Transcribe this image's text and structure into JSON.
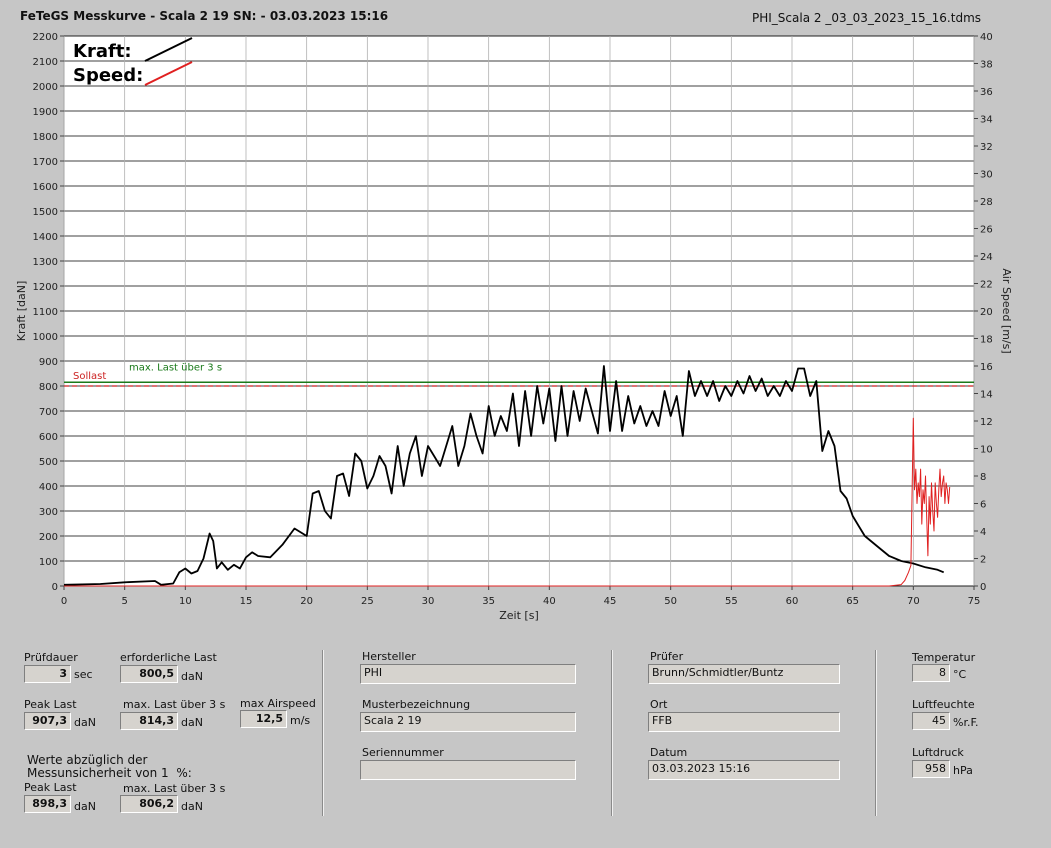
{
  "header": {
    "title": "FeTeGS Messkurve - Scala 2 19  SN:  - 03.03.2023 15:16",
    "filename": "PHI_Scala 2 _03_03_2023_15_16.tdms"
  },
  "chart_data": {
    "type": "line",
    "xlabel": "Zeit [s]",
    "ylabel": "Kraft [daN]",
    "y2label": "Air Speed [m/s]",
    "xlim": [
      0,
      75
    ],
    "ylim": [
      0,
      2200
    ],
    "y2lim": [
      0,
      40
    ],
    "x_ticks": [
      0,
      5,
      10,
      15,
      20,
      25,
      30,
      35,
      40,
      45,
      50,
      55,
      60,
      65,
      70,
      75
    ],
    "y_ticks": [
      0,
      100,
      200,
      300,
      400,
      500,
      600,
      700,
      800,
      900,
      1000,
      1100,
      1200,
      1300,
      1400,
      1500,
      1600,
      1700,
      1800,
      1900,
      2000,
      2100,
      2200
    ],
    "y2_ticks": [
      0,
      2,
      4,
      6,
      8,
      10,
      12,
      14,
      16,
      18,
      20,
      22,
      24,
      26,
      28,
      30,
      32,
      34,
      36,
      38,
      40
    ],
    "grid": true,
    "legend": [
      {
        "label": "Kraft:",
        "color": "#000000"
      },
      {
        "label": "Speed:",
        "color": "#e02020"
      }
    ],
    "reference_lines": [
      {
        "label": "Sollast",
        "value": 800,
        "color": "#cc2222",
        "style": "dashed"
      },
      {
        "label": "max. Last über  3 s",
        "value": 815,
        "color": "#1a7a1a",
        "style": "solid"
      }
    ],
    "series": [
      {
        "name": "Kraft",
        "axis": "left",
        "color": "#000000",
        "x": [
          0,
          3,
          5,
          7.5,
          8,
          9,
          9.5,
          10,
          10.5,
          11,
          11.5,
          12,
          12.3,
          12.6,
          13,
          13.5,
          14,
          14.5,
          15,
          15.5,
          16,
          17,
          18,
          19,
          20,
          20.5,
          21,
          21.5,
          22,
          22.5,
          23,
          23.5,
          24,
          24.5,
          25,
          25.5,
          26,
          26.5,
          27,
          27.5,
          28,
          28.5,
          29,
          29.5,
          30,
          30.5,
          31,
          31.5,
          32,
          32.5,
          33,
          33.5,
          34,
          34.5,
          35,
          35.5,
          36,
          36.5,
          37,
          37.5,
          38,
          38.5,
          39,
          39.5,
          40,
          40.5,
          41,
          41.5,
          42,
          42.5,
          43,
          43.5,
          44,
          44.5,
          45,
          45.5,
          46,
          46.5,
          47,
          47.5,
          48,
          48.5,
          49,
          49.5,
          50,
          50.5,
          51,
          51.5,
          52,
          52.5,
          53,
          53.5,
          54,
          54.5,
          55,
          55.5,
          56,
          56.5,
          57,
          57.5,
          58,
          58.5,
          59,
          59.5,
          60,
          60.5,
          61,
          61.5,
          62,
          62.5,
          63,
          63.5,
          64,
          64.5,
          65,
          65.5,
          66,
          67,
          68,
          69,
          70,
          71,
          72,
          72.5
        ],
        "y": [
          5,
          8,
          15,
          20,
          5,
          10,
          55,
          70,
          50,
          60,
          110,
          210,
          180,
          70,
          95,
          65,
          85,
          70,
          115,
          135,
          120,
          115,
          165,
          230,
          200,
          370,
          380,
          300,
          270,
          440,
          450,
          360,
          530,
          500,
          390,
          440,
          520,
          480,
          370,
          560,
          400,
          530,
          600,
          440,
          560,
          520,
          480,
          560,
          640,
          480,
          560,
          690,
          600,
          530,
          720,
          600,
          680,
          620,
          770,
          560,
          780,
          600,
          800,
          650,
          790,
          580,
          800,
          600,
          780,
          660,
          790,
          700,
          610,
          880,
          620,
          820,
          620,
          760,
          650,
          720,
          640,
          700,
          640,
          780,
          680,
          760,
          600,
          860,
          760,
          820,
          760,
          820,
          740,
          800,
          760,
          820,
          770,
          840,
          780,
          830,
          760,
          800,
          760,
          820,
          780,
          870,
          870,
          760,
          820,
          540,
          620,
          560,
          380,
          350,
          280,
          240,
          200,
          160,
          120,
          100,
          90,
          75,
          65,
          55
        ]
      },
      {
        "name": "Speed",
        "axis": "right",
        "color": "#e02020",
        "x": [
          0,
          20,
          40,
          60,
          68,
          69,
          69.3,
          69.6,
          69.8,
          70,
          70.1,
          70.2,
          70.3,
          70.4,
          70.5,
          70.6,
          70.7,
          70.8,
          70.9,
          71,
          71.1,
          71.2,
          71.3,
          71.4,
          71.5,
          71.6,
          71.7,
          71.8,
          71.9,
          72,
          72.1,
          72.2,
          72.3,
          72.4,
          72.5,
          72.6,
          72.7,
          72.8,
          72.9,
          73
        ],
        "y": [
          0,
          0,
          0,
          0,
          0,
          0.1,
          0.4,
          1.0,
          1.5,
          12.2,
          7.0,
          8.5,
          6.0,
          7.5,
          6.5,
          8.5,
          4.5,
          7.0,
          6.0,
          8.0,
          5.0,
          2.2,
          6.5,
          4.5,
          7.5,
          5.5,
          4.0,
          7.5,
          6.0,
          5.0,
          7.0,
          8.5,
          6.5,
          7.5,
          8.0,
          6.0,
          7.5,
          7.0,
          6.0,
          7.2
        ]
      }
    ]
  },
  "fields": {
    "pruefdauer": {
      "label": "Prüfdauer",
      "value": "3",
      "unit": "sec"
    },
    "erforderliche_last": {
      "label": "erforderliche Last",
      "value": "800,5",
      "unit": "daN"
    },
    "peak_last": {
      "label": "Peak Last",
      "value": "907,3",
      "unit": "daN"
    },
    "max_last": {
      "label": "max. Last über  3 s",
      "value": "814,3",
      "unit": "daN"
    },
    "max_airspeed": {
      "label": "max Airspeed",
      "value": "12,5",
      "unit": "m/s"
    },
    "note": "Werte abzüglich der\nMessunsicherheit von 1  %:",
    "peak_last_corr": {
      "label": "Peak Last",
      "value": "898,3",
      "unit": "daN"
    },
    "max_last_corr": {
      "label": "max. Last über  3 s",
      "value": "806,2",
      "unit": "daN"
    },
    "hersteller": {
      "label": "Hersteller",
      "value": "PHI"
    },
    "musterbezeichnung": {
      "label": "Musterbezeichnung",
      "value": "Scala 2 19"
    },
    "seriennummer": {
      "label": "Seriennummer",
      "value": ""
    },
    "pruefer": {
      "label": "Prüfer",
      "value": "Brunn/Schmidtler/Buntz"
    },
    "ort": {
      "label": "Ort",
      "value": "FFB"
    },
    "datum": {
      "label": "Datum",
      "value": "03.03.2023 15:16"
    },
    "temperatur": {
      "label": "Temperatur",
      "value": "8",
      "unit": "°C"
    },
    "luftfeuchte": {
      "label": "Luftfeuchte",
      "value": "45",
      "unit": "%r.F."
    },
    "luftdruck": {
      "label": "Luftdruck",
      "value": "958",
      "unit": "hPa"
    }
  }
}
